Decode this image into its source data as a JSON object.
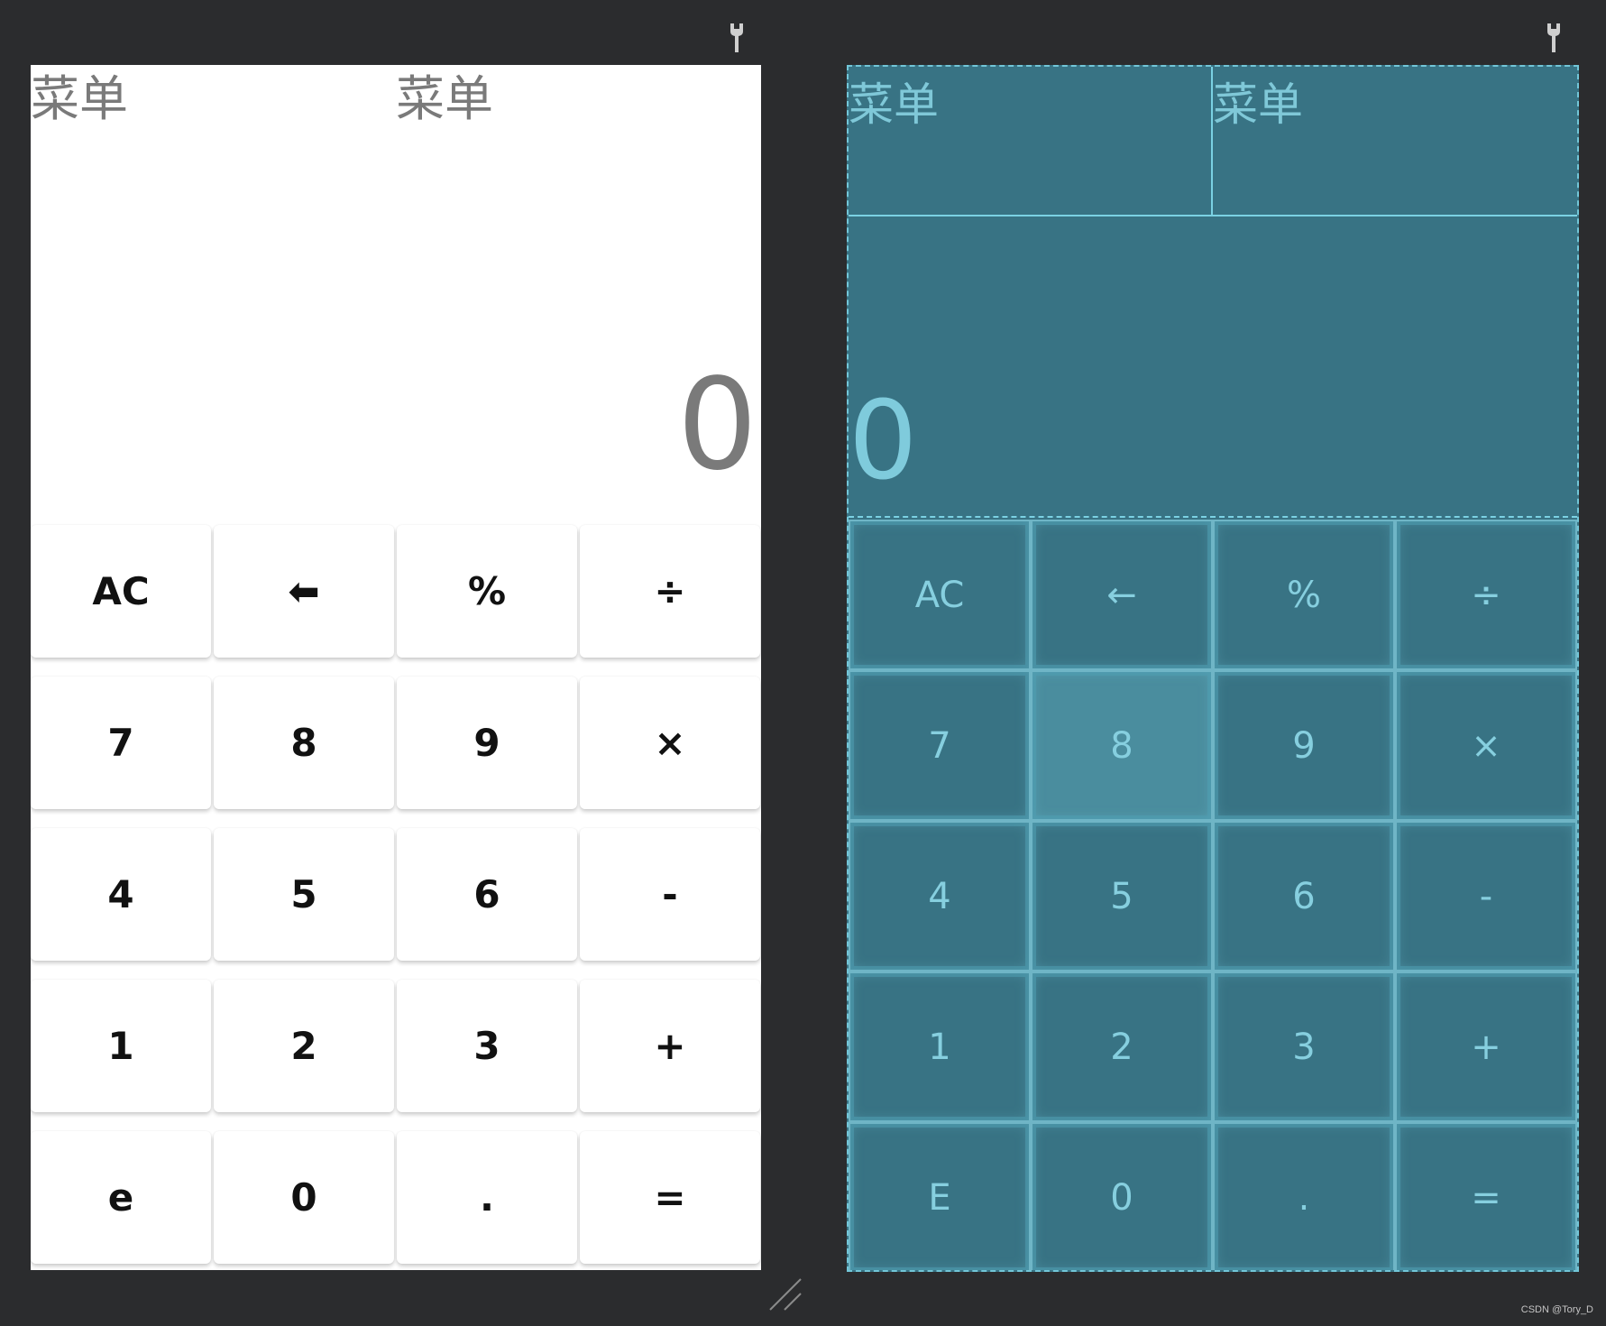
{
  "design": {
    "menu_left": "菜单",
    "menu_right": "菜单",
    "display": "0",
    "buttons": [
      "AC",
      "⬅",
      "%",
      "÷",
      "7",
      "8",
      "9",
      "×",
      "4",
      "5",
      "6",
      "-",
      "1",
      "2",
      "3",
      "+",
      "e",
      "0",
      ".",
      "="
    ]
  },
  "blueprint": {
    "menu_left": "菜单",
    "menu_right": "菜单",
    "display": "0",
    "buttons": [
      "AC",
      "←",
      "%",
      "÷",
      "7",
      "8",
      "9",
      "×",
      "4",
      "5",
      "6",
      "-",
      "1",
      "2",
      "3",
      "+",
      "E",
      "0",
      ".",
      "="
    ]
  },
  "icons": {
    "pin": "pin-icon",
    "resize": "resize-handle-icon"
  },
  "colors": {
    "canvas_background": "#2b2c2e",
    "design_background": "#ffffff",
    "blueprint_background": "#387384",
    "blueprint_line": "#7bd1e3",
    "text_gray": "#7a7a7a"
  },
  "watermark": "CSDN @Tory_D"
}
